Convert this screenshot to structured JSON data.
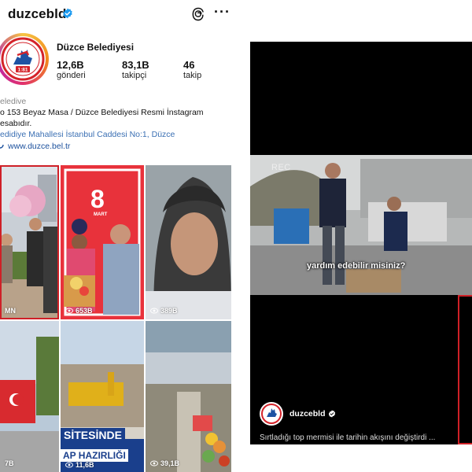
{
  "header": {
    "username": "duzcebld",
    "more_label": "···"
  },
  "profile": {
    "display_name": "Düzce Belediyesi",
    "avatar_text": "1:81",
    "stats": [
      {
        "value": "12,6B",
        "label": "gönderi"
      },
      {
        "value": "83,1B",
        "label": "takipçi"
      },
      {
        "value": "46",
        "label": "takip"
      }
    ],
    "bio": {
      "category": "eledive",
      "line1": "o 153 Beyaz Masa / Düzce Belediyesi Resmi İnstagram",
      "line2": "esabıdır.",
      "location": "edidiye  Mahallesi İstanbul Caddesi No:1, Düzce",
      "link": "www.duzce.bel.tr"
    }
  },
  "grid": {
    "tiles": [
      {
        "views": "MN"
      },
      {
        "views": "653B",
        "badge": "8",
        "badge_sub": "MART"
      },
      {
        "views": "389B"
      },
      {
        "views": "7B"
      },
      {
        "views": "11,6B",
        "overlay_top": "SİTESİNDE",
        "overlay_bottom": "AP HAZIRLIĞI"
      },
      {
        "views": "39,1B"
      }
    ]
  },
  "video": {
    "rec_label": "REC",
    "subtitle": "yardım edebilir misiniz?",
    "channel_name": "duzcebld",
    "caption": "Sırtladığı top mermisi ile tarihin akışını değiştirdi ..."
  },
  "colors": {
    "verified": "#1d9bf0",
    "highlight": "#cf2027",
    "link": "#1a4f9c"
  }
}
